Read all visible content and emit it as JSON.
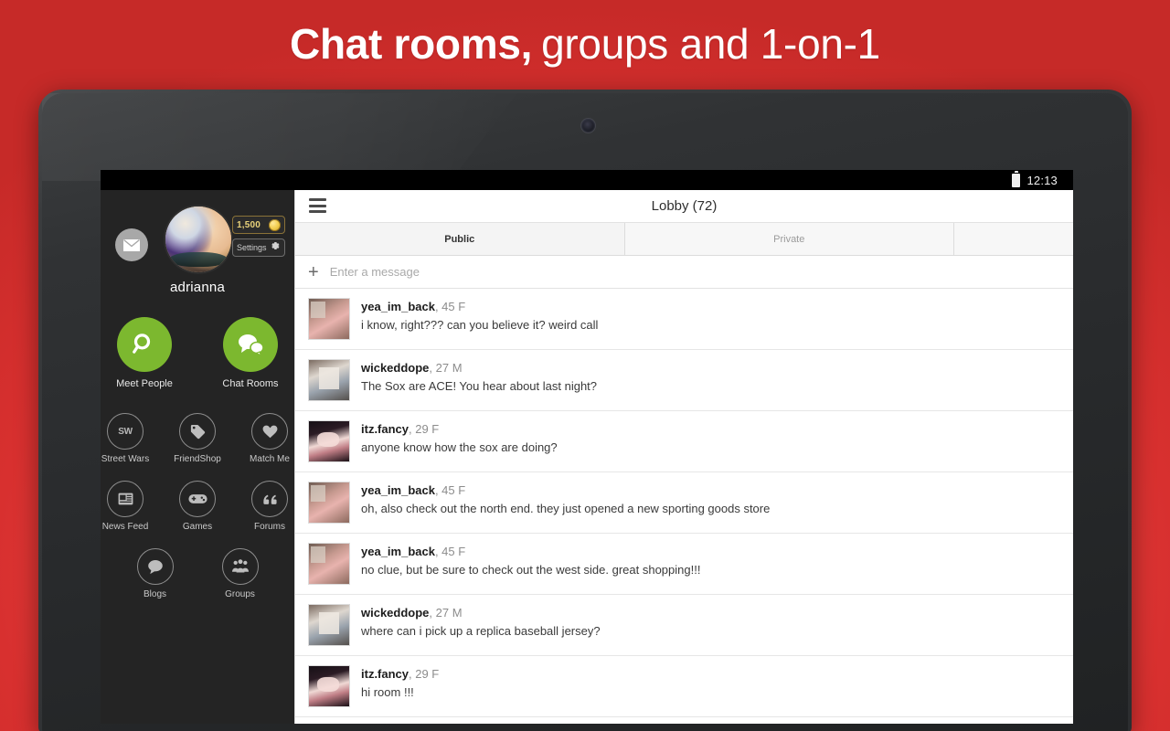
{
  "promo": {
    "headline_bold": "Chat rooms,",
    "headline_light": "groups and 1-on-1",
    "background_color": "#e04a45"
  },
  "status_bar": {
    "battery_icon": "battery-icon",
    "time": "12:13"
  },
  "sidebar": {
    "mail_icon": "envelope-icon",
    "avatar": "user-avatar",
    "coins": "1,500",
    "coin_icon": "coin-icon",
    "settings_label": "Settings",
    "settings_icon": "gear-icon",
    "username": "adrianna",
    "primary_tiles": [
      {
        "label": "Meet People",
        "icon": "magnifier-icon",
        "color": "#7cb82f"
      },
      {
        "label": "Chat Rooms",
        "icon": "chat-bubbles-icon",
        "color": "#7cb82f"
      }
    ],
    "icon_rows": [
      [
        {
          "label": "Street Wars",
          "icon": "sw-monogram-icon"
        },
        {
          "label": "FriendShop",
          "icon": "price-tag-icon"
        },
        {
          "label": "Match Me",
          "icon": "heart-icon"
        }
      ],
      [
        {
          "label": "News Feed",
          "icon": "newspaper-icon"
        },
        {
          "label": "Games",
          "icon": "gamepad-icon"
        },
        {
          "label": "Forums",
          "icon": "quote-icon"
        }
      ],
      [
        {
          "label": "Blogs",
          "icon": "speech-bubble-icon"
        },
        {
          "label": "Groups",
          "icon": "people-icon"
        }
      ]
    ]
  },
  "chat": {
    "menu_icon": "hamburger-menu-icon",
    "room_title": "Lobby (72)",
    "tabs": [
      {
        "label": "Public",
        "active": true
      },
      {
        "label": "Private",
        "active": false
      },
      {
        "label": "",
        "active": false
      }
    ],
    "composer": {
      "add_icon": "plus-icon",
      "placeholder": "Enter a message",
      "value": ""
    },
    "messages": [
      {
        "username": "yea_im_back",
        "details": ", 45 F",
        "text": "i know, right??? can you believe it? weird call",
        "avatar": "av-a"
      },
      {
        "username": "wickeddope",
        "details": ", 27 M",
        "text": "The Sox are ACE! You hear about last night?",
        "avatar": "av-b"
      },
      {
        "username": "itz.fancy",
        "details": ", 29 F",
        "text": "anyone know how the sox are doing?",
        "avatar": "av-c"
      },
      {
        "username": "yea_im_back",
        "details": ", 45 F",
        "text": "oh, also check out the north end. they just opened a new sporting goods store",
        "avatar": "av-a"
      },
      {
        "username": "yea_im_back",
        "details": ", 45 F",
        "text": "no clue, but be sure to check out the west side. great shopping!!!",
        "avatar": "av-a"
      },
      {
        "username": "wickeddope",
        "details": ", 27 M",
        "text": "where can i pick up a replica baseball jersey?",
        "avatar": "av-b"
      },
      {
        "username": "itz.fancy",
        "details": ", 29 F",
        "text": "hi room !!!",
        "avatar": "av-c"
      }
    ]
  }
}
